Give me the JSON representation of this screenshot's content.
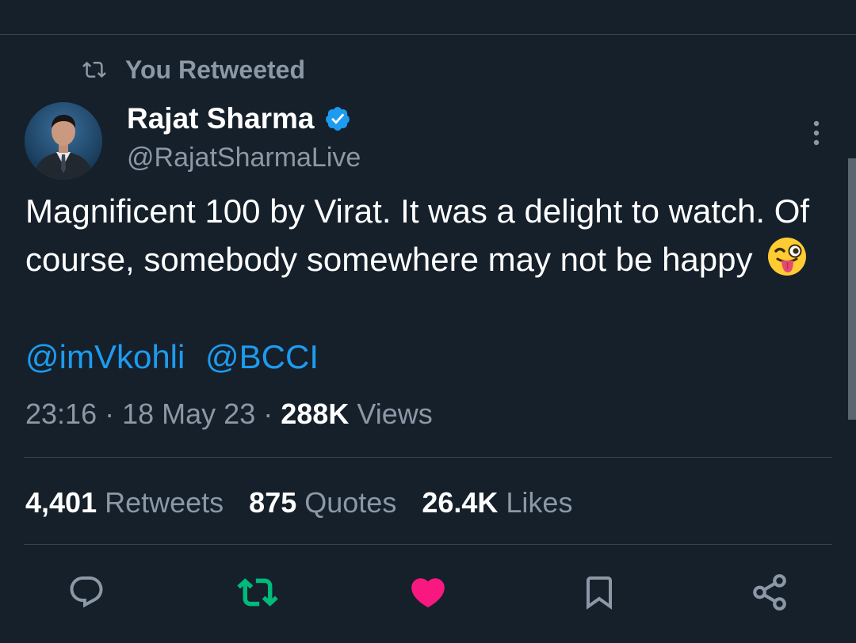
{
  "retweet_context": {
    "label": "You Retweeted"
  },
  "author": {
    "name": "Rajat Sharma",
    "handle": "@RajatSharmaLive",
    "verified": true
  },
  "tweet": {
    "text": "Magnificent 100 by Virat. It was a delight to watch. Of course, somebody somewhere may not be happy",
    "emoji": "winking-face-with-tongue",
    "mentions": [
      "@imVkohli",
      "@BCCI"
    ]
  },
  "meta": {
    "time": "23:16",
    "separator1": "·",
    "date": "18 May 23",
    "separator2": "·",
    "views_count": "288K",
    "views_label": "Views"
  },
  "stats": {
    "retweets_count": "4,401",
    "retweets_label": "Retweets",
    "quotes_count": "875",
    "quotes_label": "Quotes",
    "likes_count": "26.4K",
    "likes_label": "Likes"
  },
  "actions": {
    "reply_icon": "reply-icon",
    "retweet_icon": "retweet-icon",
    "like_icon": "heart-icon",
    "bookmark_icon": "bookmark-icon",
    "share_icon": "share-icon"
  },
  "colors": {
    "background": "#15202b",
    "text": "#ffffff",
    "muted": "#8b98a5",
    "link": "#1d9bf0",
    "retweet_active": "#00ba7c",
    "like_active": "#f91880",
    "divider": "#38444d"
  }
}
